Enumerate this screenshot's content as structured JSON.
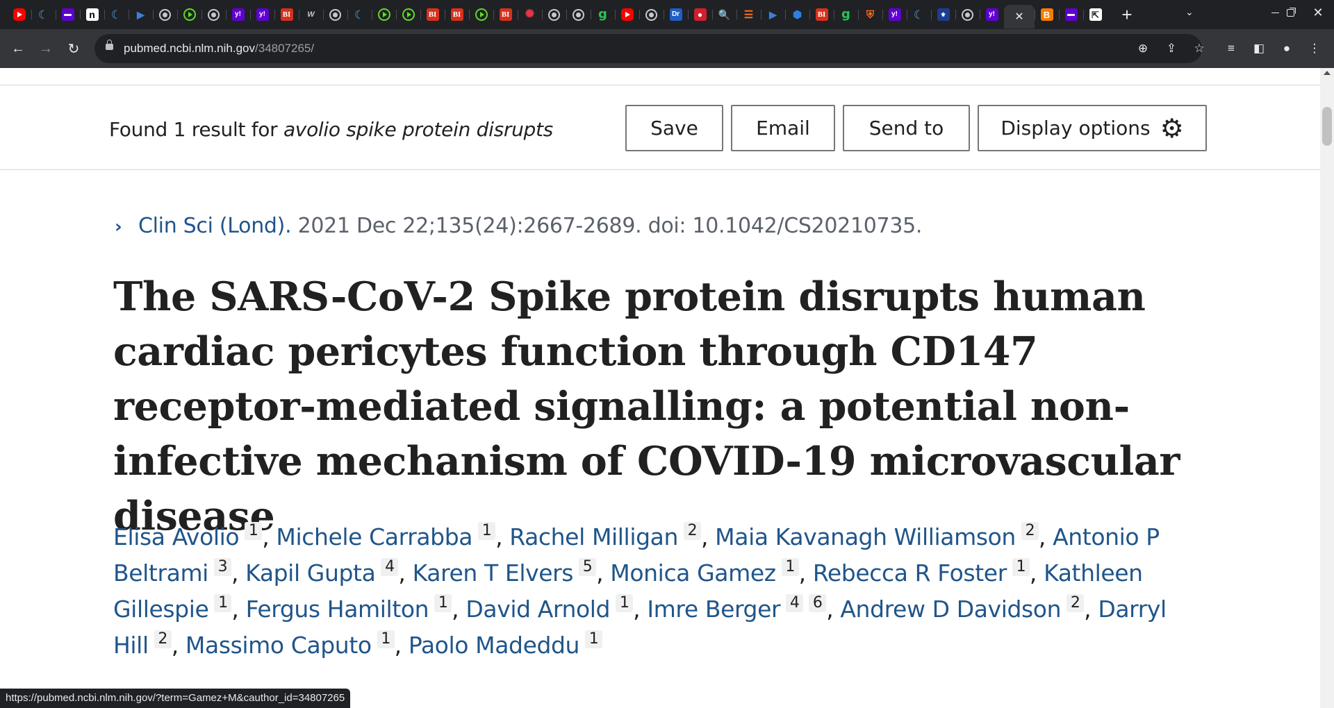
{
  "browser": {
    "tabs": [
      {
        "icon": "youtube-icon",
        "glyph": ""
      },
      {
        "icon": "c-logo-icon",
        "glyph": "☾"
      },
      {
        "icon": "mail-icon",
        "glyph": ""
      },
      {
        "icon": "n-logo-icon",
        "glyph": "n"
      },
      {
        "icon": "c-logo-icon",
        "glyph": "☾"
      },
      {
        "icon": "audible-icon",
        "glyph": "▶"
      },
      {
        "icon": "globe-icon",
        "glyph": ""
      },
      {
        "icon": "play-icon",
        "glyph": ""
      },
      {
        "icon": "globe-icon",
        "glyph": ""
      },
      {
        "icon": "yahoo-icon",
        "glyph": "y!"
      },
      {
        "icon": "yahoo-icon",
        "glyph": "y!"
      },
      {
        "icon": "business-insider-icon",
        "glyph": "BI"
      },
      {
        "icon": "wt-icon",
        "glyph": "W"
      },
      {
        "icon": "globe-icon",
        "glyph": ""
      },
      {
        "icon": "c-logo-icon",
        "glyph": "☾"
      },
      {
        "icon": "play-icon",
        "glyph": ""
      },
      {
        "icon": "play-icon",
        "glyph": ""
      },
      {
        "icon": "business-insider-icon",
        "glyph": "BI"
      },
      {
        "icon": "business-insider-icon",
        "glyph": "BI"
      },
      {
        "icon": "play-icon",
        "glyph": ""
      },
      {
        "icon": "business-insider-icon",
        "glyph": "BI"
      },
      {
        "icon": "spark-icon",
        "glyph": "✺"
      },
      {
        "icon": "globe-icon",
        "glyph": ""
      },
      {
        "icon": "globe-icon",
        "glyph": ""
      },
      {
        "icon": "g-logo-icon",
        "glyph": "g"
      },
      {
        "icon": "youtube-icon",
        "glyph": ""
      },
      {
        "icon": "globe-icon",
        "glyph": ""
      },
      {
        "icon": "dr-icon",
        "glyph": "Dr"
      },
      {
        "icon": "microphone-icon",
        "glyph": "●"
      },
      {
        "icon": "search-icon",
        "glyph": "🔍"
      },
      {
        "icon": "stack-icon",
        "glyph": "☰"
      },
      {
        "icon": "audible-icon",
        "glyph": "▶"
      },
      {
        "icon": "hexagon-icon",
        "glyph": "⬢"
      },
      {
        "icon": "business-insider-icon",
        "glyph": "BI"
      },
      {
        "icon": "g-logo-icon",
        "glyph": "g"
      },
      {
        "icon": "shield-icon",
        "glyph": "⛨"
      },
      {
        "icon": "yahoo-icon",
        "glyph": "y!"
      },
      {
        "icon": "c-logo-icon",
        "glyph": "☾"
      },
      {
        "icon": "crest-icon",
        "glyph": "⚜"
      },
      {
        "icon": "globe-icon",
        "glyph": ""
      },
      {
        "icon": "yahoo-icon",
        "glyph": "y!"
      }
    ],
    "tabs_after_active": [
      {
        "icon": "b-logo-icon",
        "glyph": "B"
      },
      {
        "icon": "mail-icon",
        "glyph": ""
      },
      {
        "icon": "exit-icon",
        "glyph": "⇱"
      }
    ],
    "active_tab_close": "✕",
    "new_tab": "+",
    "address": {
      "host": "pubmed.ncbi.nlm.nih.gov",
      "path": "/34807265/"
    },
    "status_url": "https://pubmed.ncbi.nlm.nih.gov/?term=Gamez+M&cauthor_id=34807265"
  },
  "colors": {
    "link": "#20558a",
    "chrome_dark": "#202124",
    "toolbar": "#35363a"
  },
  "results": {
    "prefix": "Found 1 result for",
    "query": "avolio spike protein disrupts"
  },
  "actions": {
    "save": "Save",
    "email": "Email",
    "send_to": "Send to",
    "display_options": "Display options"
  },
  "article": {
    "journal": "Clin Sci (Lond).",
    "citation": "2021 Dec 22;135(24):2667-2689. doi: 10.1042/CS20210735.",
    "title": "The SARS-CoV-2 Spike protein disrupts human cardiac pericytes function through CD147 receptor-mediated signalling: a potential non-infective mechanism of COVID-19 microvascular disease",
    "authors": [
      {
        "name": "Elisa Avolio",
        "affs": [
          "1"
        ]
      },
      {
        "name": "Michele Carrabba",
        "affs": [
          "1"
        ]
      },
      {
        "name": "Rachel Milligan",
        "affs": [
          "2"
        ]
      },
      {
        "name": "Maia Kavanagh Williamson",
        "affs": [
          "2"
        ]
      },
      {
        "name": "Antonio P Beltrami",
        "affs": [
          "3"
        ]
      },
      {
        "name": "Kapil Gupta",
        "affs": [
          "4"
        ]
      },
      {
        "name": "Karen T Elvers",
        "affs": [
          "5"
        ]
      },
      {
        "name": "Monica Gamez",
        "affs": [
          "1"
        ]
      },
      {
        "name": "Rebecca R Foster",
        "affs": [
          "1"
        ]
      },
      {
        "name": "Kathleen Gillespie",
        "affs": [
          "1"
        ]
      },
      {
        "name": "Fergus Hamilton",
        "affs": [
          "1"
        ]
      },
      {
        "name": "David Arnold",
        "affs": [
          "1"
        ]
      },
      {
        "name": "Imre Berger",
        "affs": [
          "4",
          "6"
        ]
      },
      {
        "name": "Andrew D Davidson",
        "affs": [
          "2"
        ]
      },
      {
        "name": "Darryl Hill",
        "affs": [
          "2"
        ]
      },
      {
        "name": "Massimo Caputo",
        "affs": [
          "1"
        ]
      },
      {
        "name": "Paolo Madeddu",
        "affs": [
          "1"
        ]
      }
    ]
  }
}
